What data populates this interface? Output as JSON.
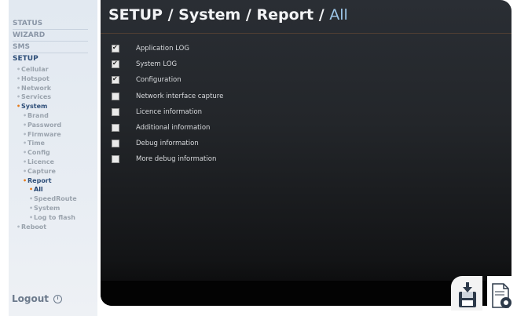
{
  "sidebar": {
    "top_sections": [
      {
        "label": "STATUS",
        "active": false
      },
      {
        "label": "WIZARD",
        "active": false
      },
      {
        "label": "SMS",
        "active": false
      },
      {
        "label": "SETUP",
        "active": true
      }
    ],
    "items": [
      {
        "label": "Cellular",
        "level": 1
      },
      {
        "label": "Hotspot",
        "level": 1
      },
      {
        "label": "Network",
        "level": 1
      },
      {
        "label": "Services",
        "level": 1
      },
      {
        "label": "System",
        "level": 1,
        "active": true
      },
      {
        "label": "Brand",
        "level": 2
      },
      {
        "label": "Password",
        "level": 2
      },
      {
        "label": "Firmware",
        "level": 2
      },
      {
        "label": "Time",
        "level": 2
      },
      {
        "label": "Config",
        "level": 2
      },
      {
        "label": "Licence",
        "level": 2
      },
      {
        "label": "Capture",
        "level": 2
      },
      {
        "label": "Report",
        "level": 2,
        "active": true
      },
      {
        "label": "All",
        "level": 3,
        "current": true
      },
      {
        "label": "SpeedRoute",
        "level": 3
      },
      {
        "label": "System",
        "level": 3
      },
      {
        "label": "Log to flash",
        "level": 3
      },
      {
        "label": "Reboot",
        "level": 1
      }
    ],
    "logout_label": "Logout"
  },
  "header": {
    "breadcrumb_path": "SETUP / System / Report /",
    "breadcrumb_current": "All"
  },
  "options": [
    {
      "label": "Application LOG",
      "checked": true
    },
    {
      "label": "System LOG",
      "checked": true
    },
    {
      "label": "Configuration",
      "checked": true
    },
    {
      "label": "Network interface capture",
      "checked": false
    },
    {
      "label": "Licence information",
      "checked": false
    },
    {
      "label": "Additional information",
      "checked": false
    },
    {
      "label": "Debug information",
      "checked": false
    },
    {
      "label": "More debug information",
      "checked": false
    }
  ],
  "actions": {
    "save_icon": "save-icon",
    "download_icon": "download-icon"
  }
}
